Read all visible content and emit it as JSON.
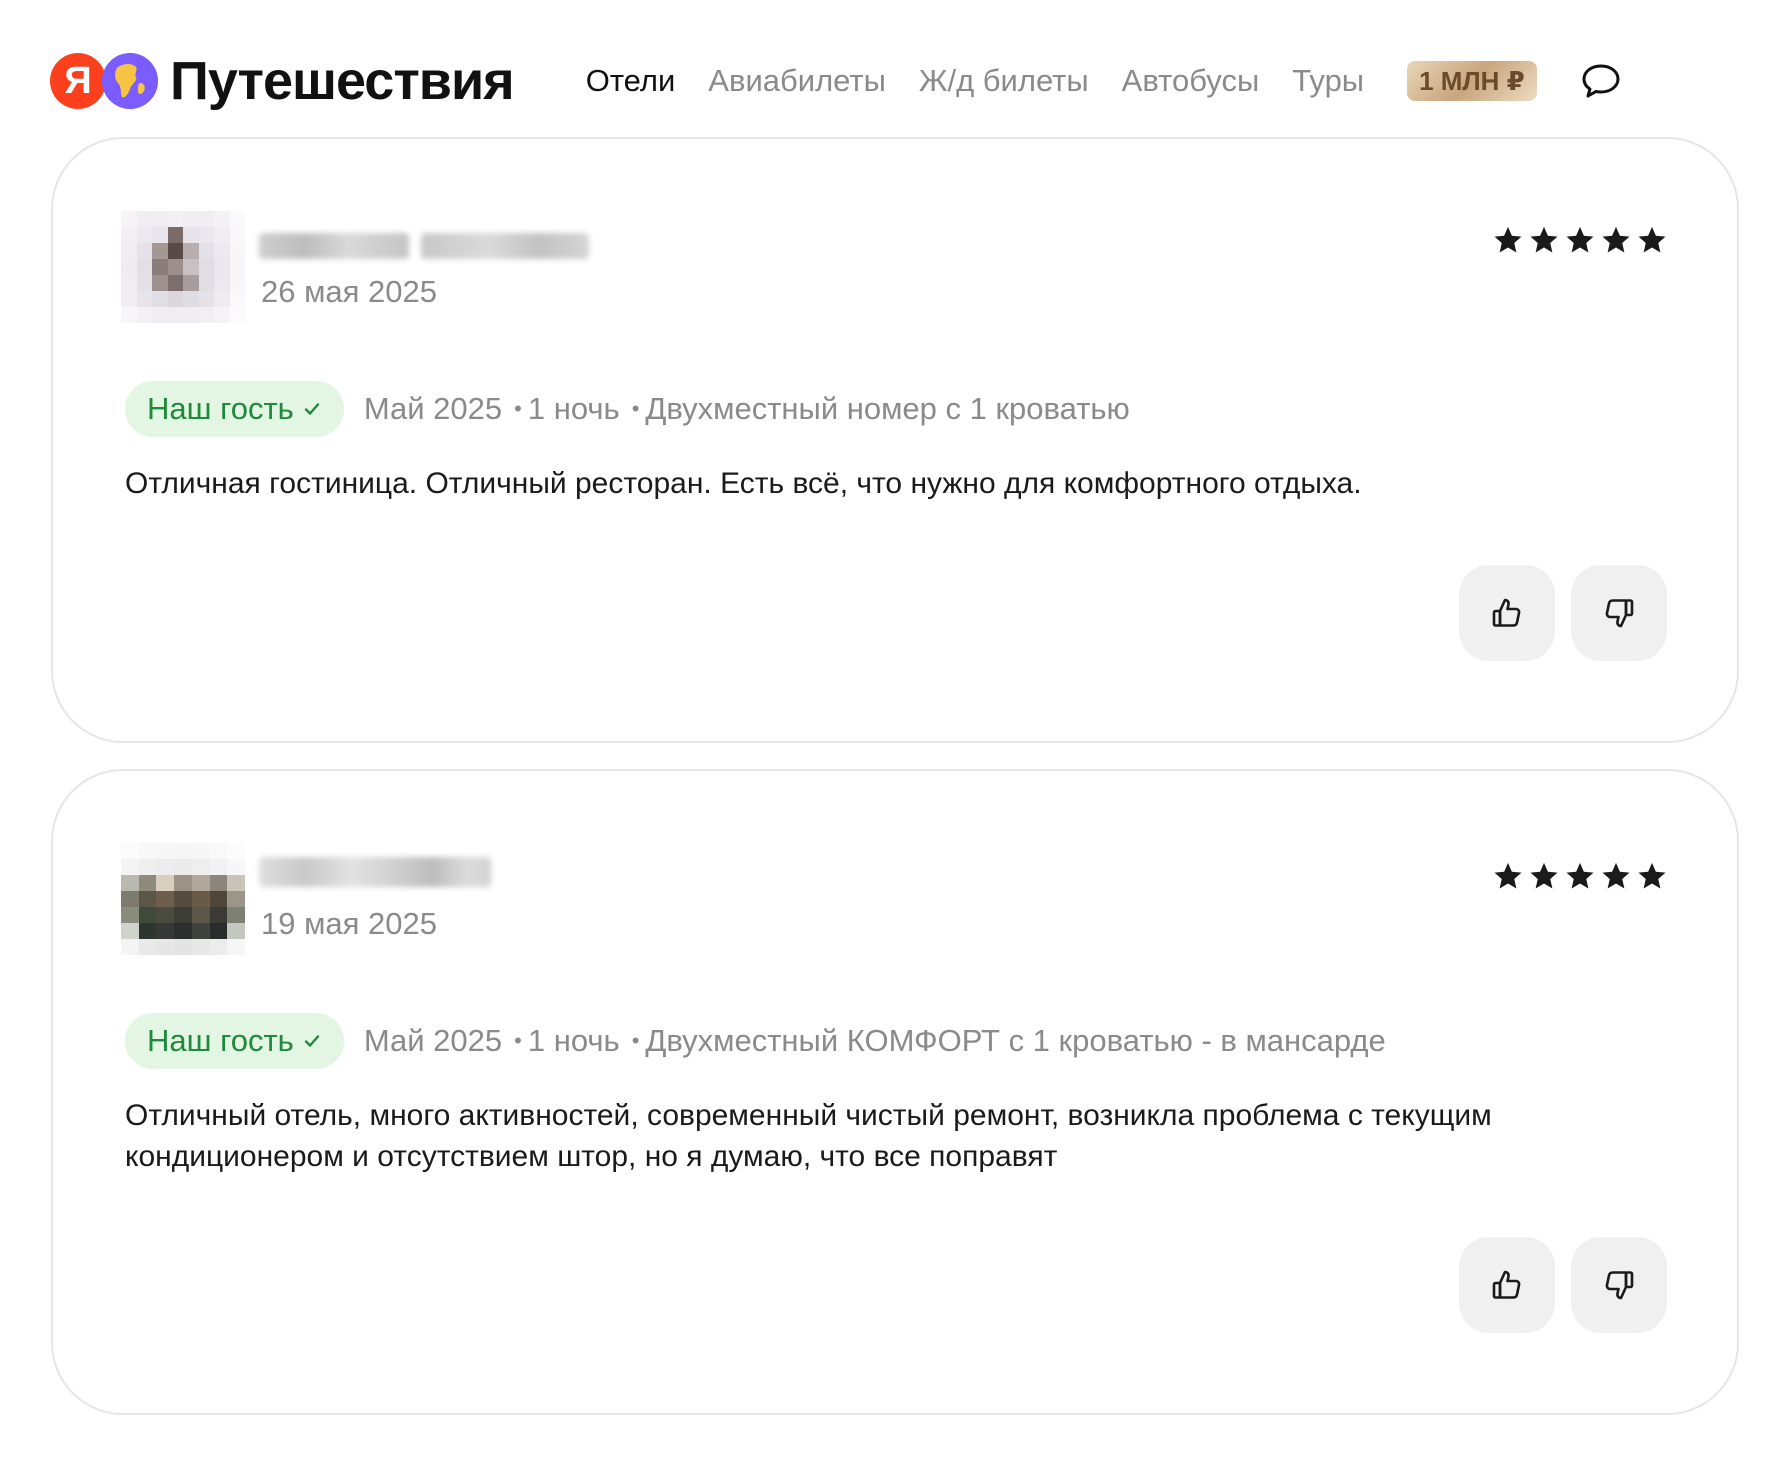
{
  "header": {
    "logo_letter": "Я",
    "logo_title": "Путешествия",
    "nav": [
      {
        "label": "Отели",
        "active": true
      },
      {
        "label": "Авиабилеты",
        "active": false
      },
      {
        "label": "Ж/д билеты",
        "active": false
      },
      {
        "label": "Автобусы",
        "active": false
      },
      {
        "label": "Туры",
        "active": false
      }
    ],
    "promo_badge": "1 МЛН ₽",
    "chat_icon": "chat-bubble-icon"
  },
  "reviews": [
    {
      "date": "26 мая 2025",
      "rating": 5,
      "guest_badge": "Наш гость",
      "stay_month": "Май 2025",
      "nights": "1 ночь",
      "room": "Двухместный номер с 1 кроватью",
      "text": "Отличная гостиница. Отличный ресторан. Есть всё, что нужно для комфортного отдыха."
    },
    {
      "date": "19 мая 2025",
      "rating": 5,
      "guest_badge": "Наш гость",
      "stay_month": "Май 2025",
      "nights": "1 ночь",
      "room": "Двухместный КОМФОРТ с 1 кроватью - в мансарде",
      "text": "Отличный отель, много активностей, современный чистый ремонт, возникла проблема с текущим кондиционером и отсутствием штор, но я думаю, что все поправят"
    }
  ],
  "colors": {
    "logo_red": "#fc3f1d",
    "logo_purple": "#7a5cff",
    "guest_badge_bg": "#e2f6e3",
    "guest_badge_text": "#1f8a3b",
    "muted_text": "#8a8a8a",
    "card_border": "#e6e6e6",
    "vote_button_bg": "#f0f0f0"
  },
  "icons": {
    "rating": "star-icon",
    "like": "thumbs-up-icon",
    "dislike": "thumbs-down-icon",
    "verified": "checkmark-icon"
  }
}
